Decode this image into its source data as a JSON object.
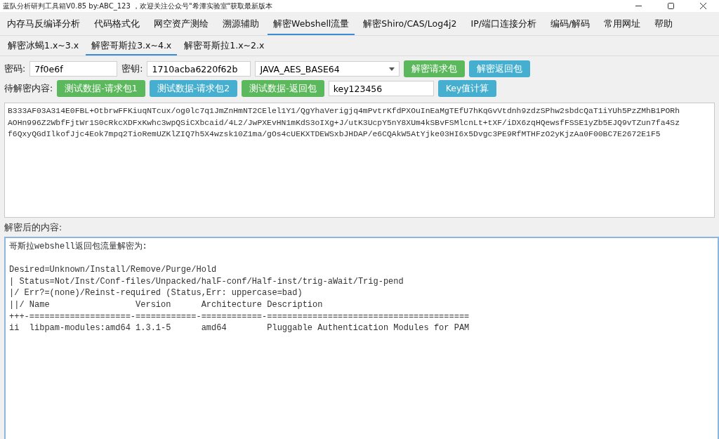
{
  "window": {
    "title": "蓝队分析研判工具箱V0.85 by:ABC_123 ，欢迎关注公众号\"希潭实验室\"获取最新版本"
  },
  "menu": [
    {
      "label": "内存马反编译分析",
      "selected": false
    },
    {
      "label": "代码格式化",
      "selected": false
    },
    {
      "label": "网空资产测绘",
      "selected": false
    },
    {
      "label": "溯源辅助",
      "selected": false
    },
    {
      "label": "解密Webshell流量",
      "selected": true
    },
    {
      "label": "解密Shiro/CAS/Log4j2",
      "selected": false
    },
    {
      "label": "IP/端口连接分析",
      "selected": false
    },
    {
      "label": "编码/解码",
      "selected": false
    },
    {
      "label": "常用网址",
      "selected": false
    },
    {
      "label": "帮助",
      "selected": false
    }
  ],
  "sub_tabs": [
    {
      "label": "解密冰蝎1.x~3.x",
      "selected": false
    },
    {
      "label": "解密哥斯拉3.x~4.x",
      "selected": true
    },
    {
      "label": "解密哥斯拉1.x~2.x",
      "selected": false
    }
  ],
  "row_1": [
    {
      "kind": "label",
      "text": "密码:"
    },
    {
      "kind": "field",
      "value": "7f0e6f"
    },
    {
      "kind": "label",
      "text": "密钥:"
    },
    {
      "kind": "field",
      "value": "1710acba6220f62b"
    },
    {
      "kind": "select",
      "value": "JAVA_AES_BASE64"
    },
    {
      "kind": "button",
      "text": "解密请求包",
      "color": "#5cb85c"
    },
    {
      "kind": "button",
      "text": "解密返回包",
      "color": "#46afcf"
    }
  ],
  "row_2": [
    {
      "kind": "label",
      "text": "待解密内容:"
    },
    {
      "kind": "button",
      "text": "测试数据-请求包1",
      "color": "#5cb85c"
    },
    {
      "kind": "button",
      "text": "测试数据-请求包2",
      "color": "#46afcf"
    },
    {
      "kind": "button",
      "text": "测试数据-返回包",
      "color": "#5cb85c"
    },
    {
      "kind": "field",
      "value": "key123456"
    },
    {
      "kind": "button",
      "text": "Key值计算",
      "color": "#46afcf"
    }
  ],
  "input_text": [
    "B333AF03A314E0FBL+OtbrwFFKiuqNTcux/og0lc7q1JmZnHmNT2CElel1Y1/QgYhaVerigjq4mPvtrKfdPXOuInEaMgTEfU7hKqGvVtdnh9zdzSPhw2sbdcQaT1iYUh5PzZMhB1PORh",
    "AOHn996Z2WbfFjtWr1S0cRkcXDFxKwhc3wpQSiCXbcaid/4L2/JwPXEvHN1mKdS3oIXg+J/utK3UcpY5nY8XUm4kSBvFSMlcnLt+tXF/iDX6zqHQewsfFSSE1yZb5EJQ9vTZun7fa4Sz",
    "f6QxyQGdIlkofJjc4Eok7mpq2TioRemUZKlZIQ7h5X4wzsk10Z1ma/gOs4cUEKXTDEWSxbJHDAP/e6CQAkW5AtYjke03HI6x5Dvgc3PE9RfMTHFzO2yKjzAa0F00BC7E2672E1F5"
  ],
  "output_label": "解密后的内容:",
  "output_heading": "哥斯拉webshell返回包流量解密为:",
  "output_text": [
    "Desired=Unknown/Install/Remove/Purge/Hold",
    "| Status=Not/Inst/Conf-files/Unpacked/halF-conf/Half-inst/trig-aWait/Trig-pend",
    "|/ Err?=(none)/Reinst-required (Status,Err: uppercase=bad)",
    "||/ Name                 Version      Architecture Description",
    "+++-====================-============-============-========================================",
    "ii  libpam-modules:amd64 1.3.1-5      amd64        Pluggable Authentication Modules for PAM"
  ]
}
